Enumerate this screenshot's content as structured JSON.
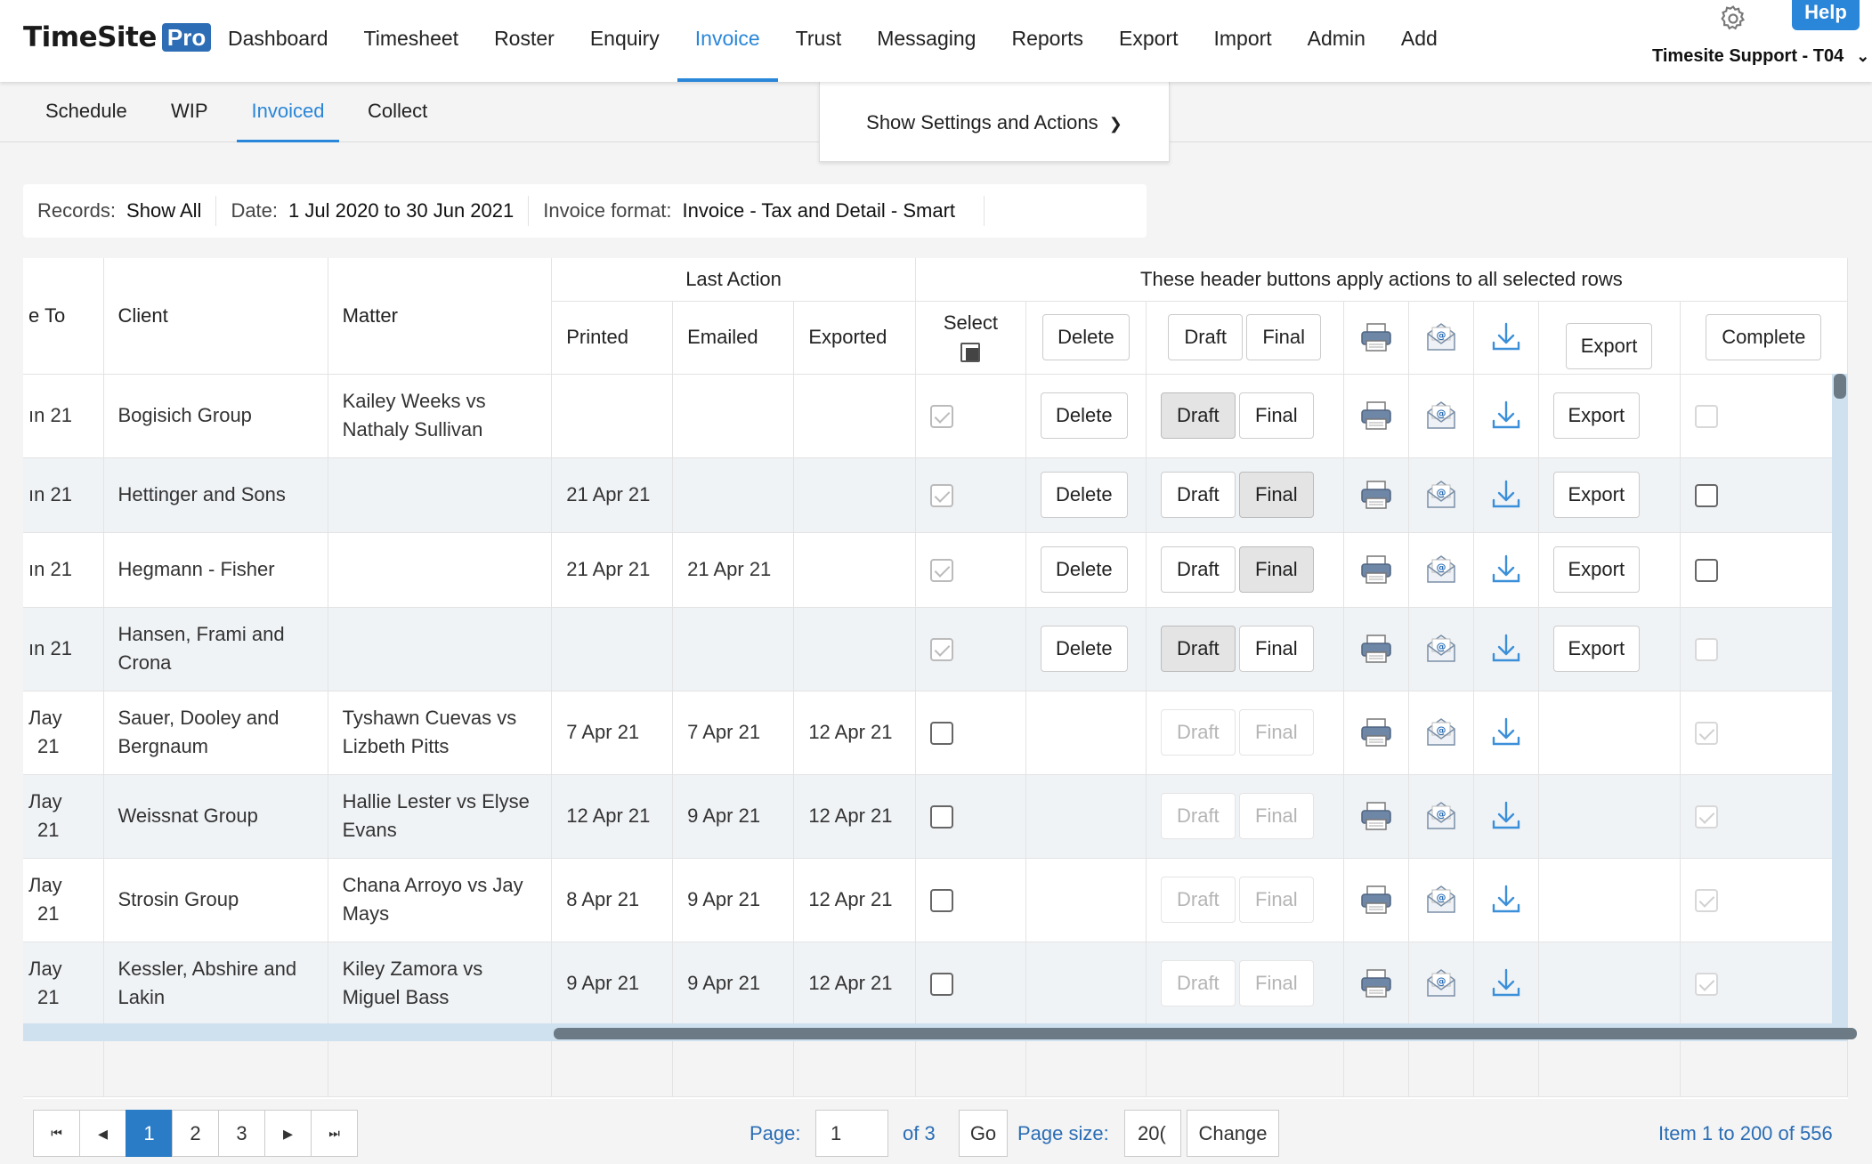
{
  "app": {
    "logo_text": "TimeSite",
    "logo_badge": "Pro",
    "help_label": "Help",
    "user_label": "Timesite Support - T04"
  },
  "nav": [
    "Dashboard",
    "Timesheet",
    "Roster",
    "Enquiry",
    "Invoice",
    "Trust",
    "Messaging",
    "Reports",
    "Export",
    "Import",
    "Admin",
    "Add"
  ],
  "nav_active": "Invoice",
  "subnav": [
    "Schedule",
    "WIP",
    "Invoiced",
    "Collect"
  ],
  "subnav_active": "Invoiced",
  "settings_label": "Show Settings and Actions",
  "filters": {
    "records_label": "Records:",
    "records_value": "Show All",
    "date_label": "Date:",
    "date_value": "1 Jul 2020 to 30 Jun 2021",
    "format_label": "Invoice format:",
    "format_value": "Invoice - Tax and Detail - Smart"
  },
  "grid": {
    "headers": {
      "date_to": "e To",
      "client": "Client",
      "matter": "Matter",
      "last_action": "Last Action",
      "printed": "Printed",
      "emailed": "Emailed",
      "exported": "Exported",
      "actions_banner": "These header buttons apply actions to all selected rows",
      "select": "Select",
      "delete": "Delete",
      "draft": "Draft",
      "final": "Final",
      "export": "Export",
      "complete": "Complete"
    },
    "rows": [
      {
        "date_to": "ın 21",
        "client": "Bogisich Group",
        "matter": "Kailey Weeks vs Nathaly Sullivan",
        "printed": "",
        "emailed": "",
        "exported": "",
        "selected": true,
        "draft_pressed": true,
        "final_pressed": false,
        "actionable": true,
        "complete": "faint"
      },
      {
        "date_to": "ın 21",
        "client": "Hettinger and Sons",
        "matter": "",
        "printed": "21 Apr 21",
        "emailed": "",
        "exported": "",
        "selected": true,
        "draft_pressed": false,
        "final_pressed": true,
        "actionable": true,
        "complete": "dark"
      },
      {
        "date_to": "ın 21",
        "client": "Hegmann - Fisher",
        "matter": "",
        "printed": "21 Apr 21",
        "emailed": "21 Apr 21",
        "exported": "",
        "selected": true,
        "draft_pressed": false,
        "final_pressed": true,
        "actionable": true,
        "complete": "dark"
      },
      {
        "date_to": "ın 21",
        "client": "Hansen, Frami and Crona",
        "matter": "",
        "printed": "",
        "emailed": "",
        "exported": "",
        "selected": true,
        "draft_pressed": true,
        "final_pressed": false,
        "actionable": true,
        "complete": "faint"
      },
      {
        "date_to": "Лay 21",
        "client": "Sauer, Dooley and Bergnaum",
        "matter": "Tyshawn Cuevas vs Lizbeth Pitts",
        "printed": "7 Apr 21",
        "emailed": "7 Apr 21",
        "exported": "12 Apr 21",
        "selected": false,
        "draft_pressed": false,
        "final_pressed": false,
        "actionable": false,
        "complete": "faint-checked"
      },
      {
        "date_to": "Лay 21",
        "client": "Weissnat Group",
        "matter": "Hallie Lester vs Elyse Evans",
        "printed": "12 Apr 21",
        "emailed": "9 Apr 21",
        "exported": "12 Apr 21",
        "selected": false,
        "draft_pressed": false,
        "final_pressed": false,
        "actionable": false,
        "complete": "faint-checked"
      },
      {
        "date_to": "Лay 21",
        "client": "Strosin Group",
        "matter": "Chana Arroyo vs Jay Mays",
        "printed": "8 Apr 21",
        "emailed": "9 Apr 21",
        "exported": "12 Apr 21",
        "selected": false,
        "draft_pressed": false,
        "final_pressed": false,
        "actionable": false,
        "complete": "faint-checked"
      },
      {
        "date_to": "Лay 21",
        "client": "Kessler, Abshire and Lakin",
        "matter": "Kiley Zamora vs Miguel Bass",
        "printed": "9 Apr 21",
        "emailed": "9 Apr 21",
        "exported": "12 Apr 21",
        "selected": false,
        "draft_pressed": false,
        "final_pressed": false,
        "actionable": false,
        "complete": "faint-checked"
      }
    ]
  },
  "pager": {
    "pages": [
      "1",
      "2",
      "3"
    ],
    "current": "1",
    "first": "⏮",
    "prev": "◂",
    "next": "▸",
    "last": "⏭",
    "page_label": "Page:",
    "page_value": "1",
    "of_label": "of 3",
    "go_label": "Go",
    "size_label": "Page size:",
    "size_value": "20(",
    "change_label": "Change",
    "summary": "Item 1 to 200 of 556"
  },
  "colors": {
    "accent": "#2a86d8",
    "pager_active": "#2a7cc7",
    "row_alt": "#f0f3f6",
    "icon_blue": "#3b8fd9"
  }
}
